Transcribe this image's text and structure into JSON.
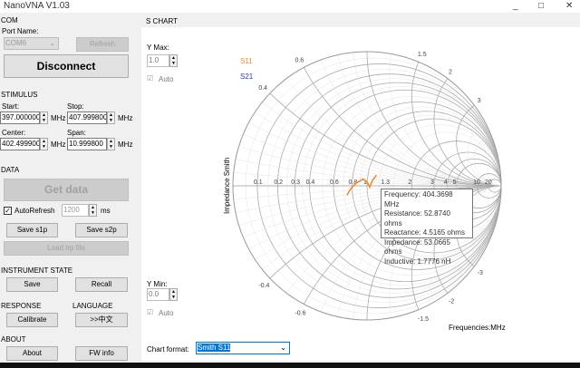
{
  "window": {
    "title": "NanoVNA V1.03",
    "minimize": "_",
    "maximize": "□",
    "close": "✕"
  },
  "com": {
    "header": "COM",
    "port_label": "Port Name:",
    "port_value": "COM6",
    "refresh": "Refresh",
    "disconnect": "Disconnect"
  },
  "stimulus": {
    "header": "STIMULUS",
    "start_label": "Start:",
    "start": "397.000000",
    "stop_label": "Stop:",
    "stop": "407.999800",
    "center_label": "Center:",
    "center": "402.499900",
    "span_label": "Span:",
    "span": "10.999800",
    "unit": "MHz"
  },
  "data": {
    "header": "DATA",
    "get_data": "Get data",
    "auto_refresh": "AutoRefresh",
    "auto_refresh_checked": true,
    "interval": "1200",
    "interval_unit": "ms",
    "save_s1p": "Save s1p",
    "save_s2p": "Save s2p",
    "load_trp": "Load trp file"
  },
  "instrument": {
    "header": "INSTRUMENT STATE",
    "save": "Save",
    "recall": "Recall"
  },
  "response": {
    "header": "RESPONSE",
    "calibrate": "Calibrate"
  },
  "language": {
    "header": "LANGUAGE",
    "switch": ">>中文"
  },
  "about": {
    "header": "ABOUT",
    "about": "About",
    "fw_info": "FW info"
  },
  "schart": {
    "header": "S CHART",
    "ymax_label": "Y Max:",
    "ymax": "1.0",
    "ymin_label": "Y Min:",
    "ymin": "0.0",
    "auto": "Auto",
    "chart_format_label": "Chart format:",
    "chart_format": "Smith S11",
    "freq_label": "Frequencies:MHz"
  },
  "tooltip": {
    "frequency": "Frequency: 404.3698 MHz",
    "resistance": "Resistance: 52.8740 ohms",
    "reactance": "Reactance: 4.5165 ohms",
    "impedance": "Impedance: 53.0665 ohms",
    "inductive": "Inductive: 1.7776 nH"
  },
  "chart_data": {
    "type": "smith",
    "ylabel": "Impedance Smith",
    "legend": [
      {
        "name": "S11",
        "color": "#f08c2c"
      },
      {
        "name": "S21",
        "color": "#3030d0"
      }
    ],
    "real_ticks": [
      "0.1",
      "0.2",
      "0.3",
      "0.4",
      "0.6",
      "0.8",
      "1",
      "1.3",
      "2",
      "3",
      "4",
      "5",
      "10",
      "20"
    ],
    "real_values": [
      0.1,
      0.2,
      0.3,
      0.4,
      0.6,
      0.8,
      1,
      1.3,
      2,
      3,
      4,
      5,
      10,
      20
    ],
    "imag_ticks": [
      "0.4",
      "0.6",
      "1.5",
      "2",
      "3",
      "-0.4",
      "-0.6",
      "-1.5",
      "-2",
      "-3"
    ],
    "imag_values": [
      0.4,
      0.6,
      1.5,
      2,
      3,
      -0.4,
      -0.6,
      -1.5,
      -2,
      -3
    ],
    "s11_gamma": [
      [
        -0.15,
        -0.07
      ],
      [
        -0.12,
        -0.02
      ],
      [
        -0.08,
        0.02
      ],
      [
        -0.03,
        0.05
      ],
      [
        0.0,
        0.03
      ],
      [
        0.02,
        -0.01
      ],
      [
        0.04,
        0.04
      ],
      [
        0.07,
        0.08
      ]
    ]
  }
}
